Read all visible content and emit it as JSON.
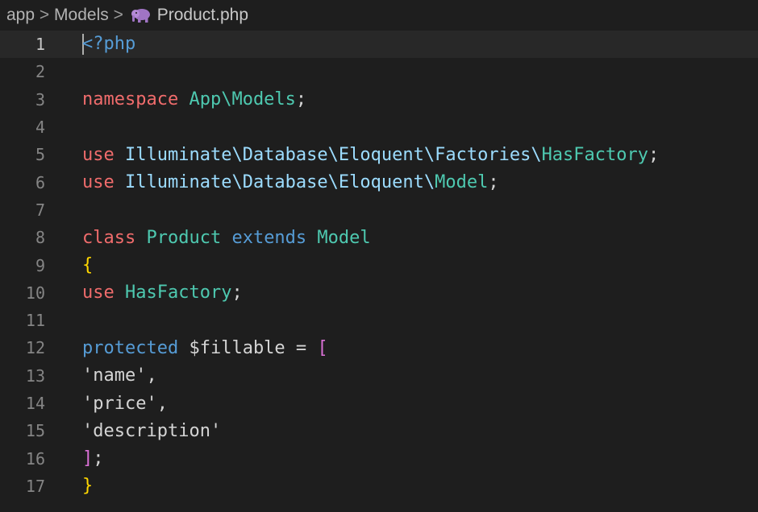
{
  "breadcrumb": {
    "items": [
      "app",
      "Models",
      "Product.php"
    ],
    "separator": ">",
    "file_icon": "php-elephant-icon"
  },
  "colors": {
    "background": "#1e1e1e",
    "keyword": "#f06c6c",
    "namespace": "#4ec9b0",
    "path": "#9cdcfe",
    "modifier": "#569cd6",
    "brace": "#ffd700",
    "bracket": "#da70d6",
    "text": "#d4d4d4"
  },
  "lines": [
    {
      "number": "1",
      "tokens": [
        "<?php"
      ]
    },
    {
      "number": "2",
      "tokens": []
    },
    {
      "number": "3",
      "tokens": [
        "namespace",
        " ",
        "App\\Models",
        ";"
      ]
    },
    {
      "number": "4",
      "tokens": []
    },
    {
      "number": "5",
      "tokens": [
        "use",
        " ",
        "Illuminate\\Database\\Eloquent\\Factories\\",
        "HasFactory",
        ";"
      ]
    },
    {
      "number": "6",
      "tokens": [
        "use",
        " ",
        "Illuminate\\Database\\Eloquent\\",
        "Model",
        ";"
      ]
    },
    {
      "number": "7",
      "tokens": []
    },
    {
      "number": "8",
      "tokens": [
        "class",
        " ",
        "Product",
        " ",
        "extends",
        " ",
        "Model"
      ]
    },
    {
      "number": "9",
      "tokens": [
        "{"
      ]
    },
    {
      "number": "10",
      "tokens": [
        "use",
        " ",
        "HasFactory",
        ";"
      ]
    },
    {
      "number": "11",
      "tokens": []
    },
    {
      "number": "12",
      "tokens": [
        "protected",
        " ",
        "$fillable",
        " = ",
        "["
      ]
    },
    {
      "number": "13",
      "tokens": [
        "'name'",
        ","
      ]
    },
    {
      "number": "14",
      "tokens": [
        "'price'",
        ","
      ]
    },
    {
      "number": "15",
      "tokens": [
        "'description'"
      ]
    },
    {
      "number": "16",
      "tokens": [
        "]",
        ";"
      ]
    },
    {
      "number": "17",
      "tokens": [
        "}"
      ]
    }
  ]
}
